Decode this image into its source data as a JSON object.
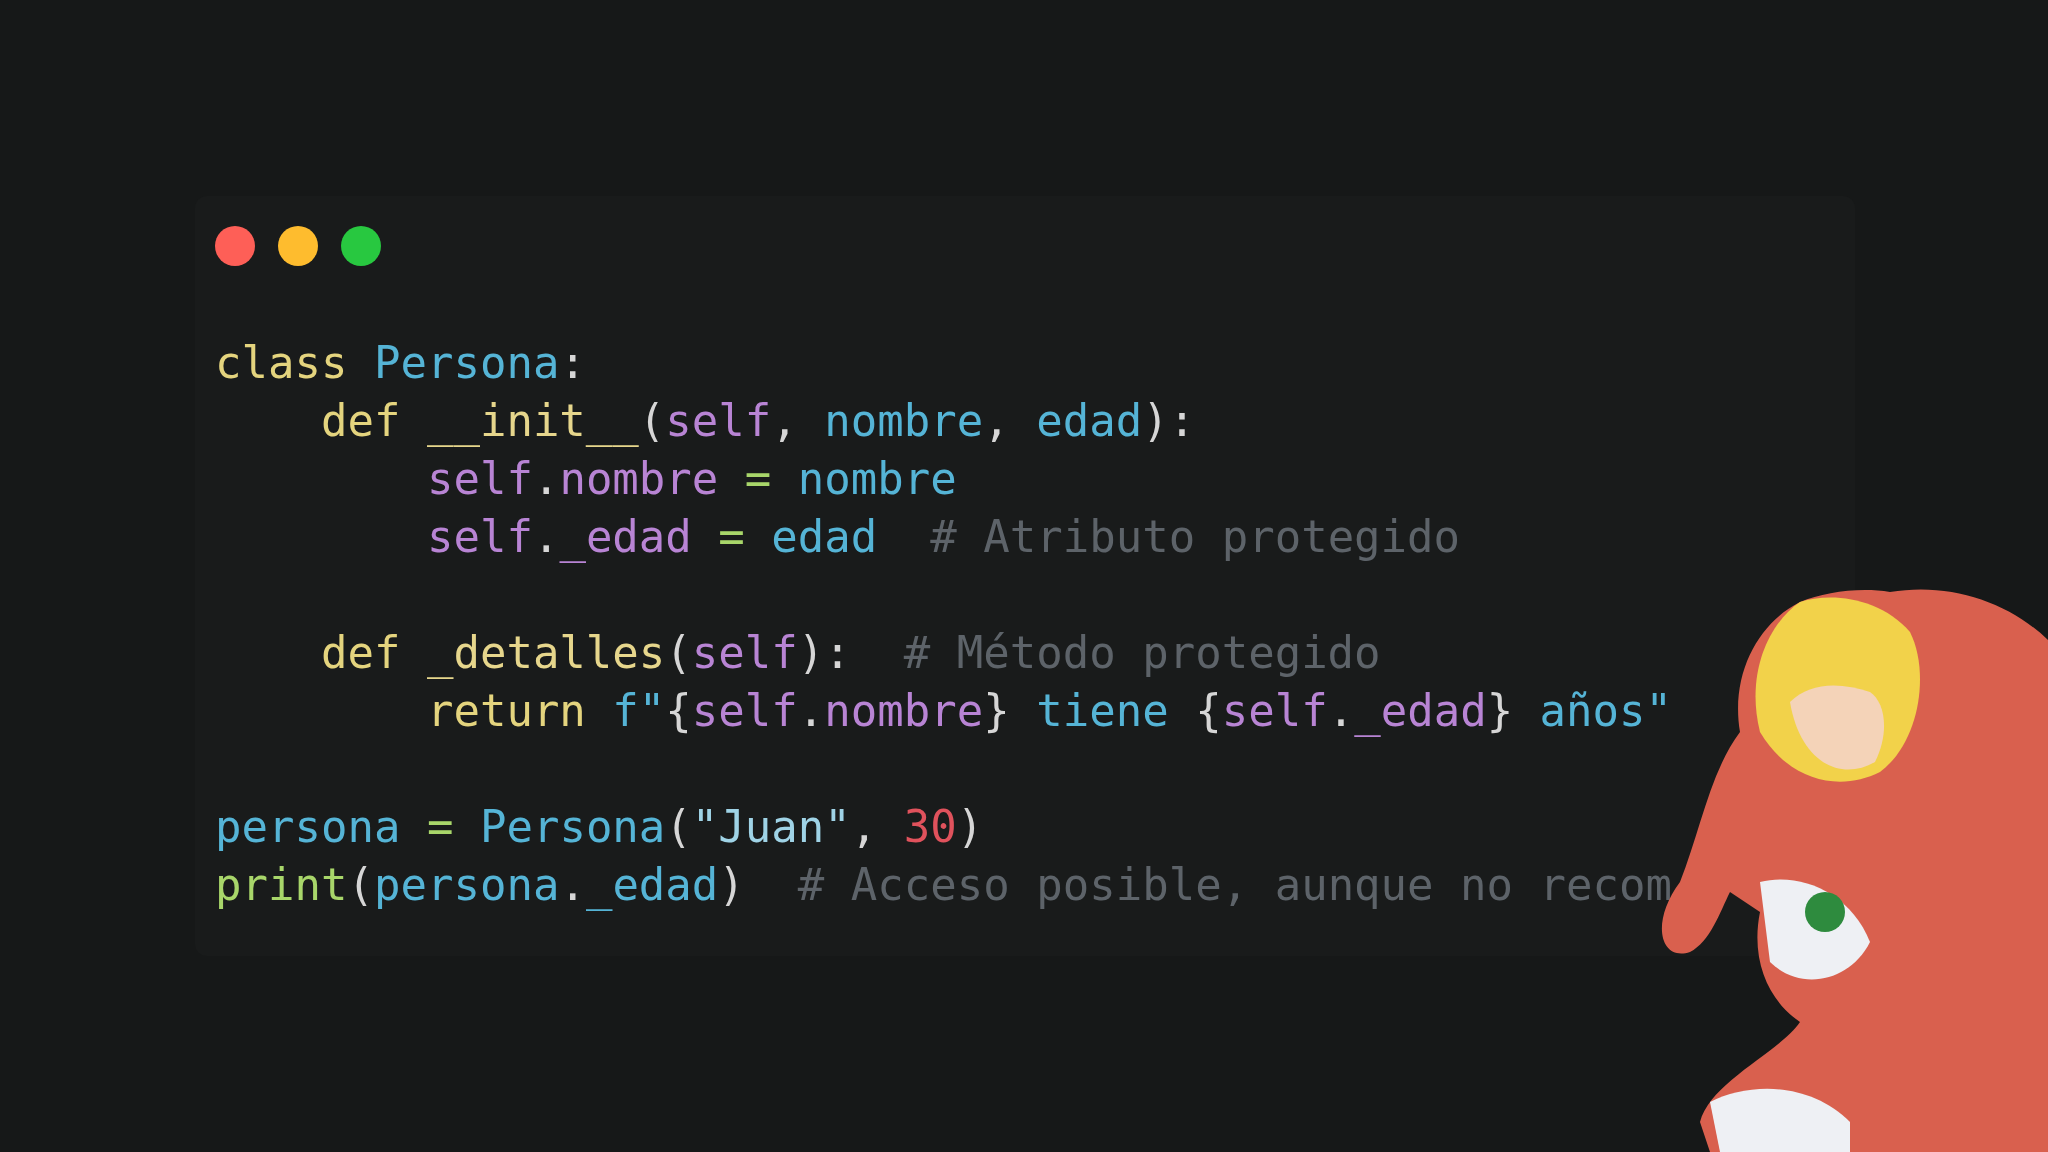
{
  "window": {
    "controls": [
      {
        "color": "#fe5f57"
      },
      {
        "color": "#febc2e"
      },
      {
        "color": "#28c840"
      }
    ]
  },
  "code": [
    {
      "tokens": [
        {
          "kind": "keyword",
          "text": "class "
        },
        {
          "kind": "name",
          "text": "Persona"
        },
        {
          "kind": "punct",
          "text": ":"
        }
      ],
      "children": [
        {
          "tokens": [
            {
              "kind": "keyword",
              "text": "def "
            },
            {
              "kind": "func",
              "text": "__init__"
            },
            {
              "kind": "punct",
              "text": "("
            },
            {
              "kind": "self",
              "text": "self"
            },
            {
              "kind": "punct",
              "text": ", "
            },
            {
              "kind": "name",
              "text": "nombre"
            },
            {
              "kind": "punct",
              "text": ", "
            },
            {
              "kind": "name",
              "text": "edad"
            },
            {
              "kind": "punct",
              "text": "):"
            }
          ],
          "children": [
            {
              "tokens": [
                {
                  "kind": "self",
                  "text": "self"
                },
                {
                  "kind": "punct",
                  "text": "."
                },
                {
                  "kind": "self",
                  "text": "nombre"
                },
                {
                  "kind": "op",
                  "text": " = "
                },
                {
                  "kind": "name",
                  "text": "nombre"
                }
              ]
            },
            {
              "tokens": [
                {
                  "kind": "self",
                  "text": "self"
                },
                {
                  "kind": "punct",
                  "text": "."
                },
                {
                  "kind": "self",
                  "text": "_edad"
                },
                {
                  "kind": "op",
                  "text": " = "
                },
                {
                  "kind": "name",
                  "text": "edad"
                },
                {
                  "kind": "comment",
                  "text": "  # Atributo protegido"
                }
              ]
            }
          ]
        },
        {
          "blank_before": true,
          "tokens": [
            {
              "kind": "keyword",
              "text": "def "
            },
            {
              "kind": "func",
              "text": "_detalles"
            },
            {
              "kind": "punct",
              "text": "("
            },
            {
              "kind": "self",
              "text": "self"
            },
            {
              "kind": "punct",
              "text": "):"
            },
            {
              "kind": "comment",
              "text": "  # Método protegido"
            }
          ],
          "children": [
            {
              "tokens": [
                {
                  "kind": "keyword",
                  "text": "return "
                },
                {
                  "kind": "name",
                  "text": "f\""
                },
                {
                  "kind": "punct",
                  "text": "{"
                },
                {
                  "kind": "self",
                  "text": "self"
                },
                {
                  "kind": "punct",
                  "text": "."
                },
                {
                  "kind": "self",
                  "text": "nombre"
                },
                {
                  "kind": "punct",
                  "text": "}"
                },
                {
                  "kind": "name",
                  "text": " tiene "
                },
                {
                  "kind": "punct",
                  "text": "{"
                },
                {
                  "kind": "self",
                  "text": "self"
                },
                {
                  "kind": "punct",
                  "text": "."
                },
                {
                  "kind": "self",
                  "text": "_edad"
                },
                {
                  "kind": "punct",
                  "text": "}"
                },
                {
                  "kind": "name",
                  "text": " años\""
                }
              ]
            }
          ]
        }
      ]
    },
    {
      "blank_before": true,
      "tokens": [
        {
          "kind": "name",
          "text": "persona"
        },
        {
          "kind": "op",
          "text": " = "
        },
        {
          "kind": "name",
          "text": "Persona"
        },
        {
          "kind": "punct",
          "text": "("
        },
        {
          "kind": "string",
          "text": "\"Juan\""
        },
        {
          "kind": "punct",
          "text": ", "
        },
        {
          "kind": "number",
          "text": "30"
        },
        {
          "kind": "punct",
          "text": ")"
        }
      ]
    },
    {
      "tokens": [
        {
          "kind": "builtin",
          "text": "print"
        },
        {
          "kind": "punct",
          "text": "("
        },
        {
          "kind": "name",
          "text": "persona"
        },
        {
          "kind": "punct",
          "text": "."
        },
        {
          "kind": "name",
          "text": "_edad"
        },
        {
          "kind": "punct",
          "text": ")"
        },
        {
          "kind": "comment",
          "text": "  # Acceso posible, aunque no recom"
        }
      ]
    }
  ]
}
